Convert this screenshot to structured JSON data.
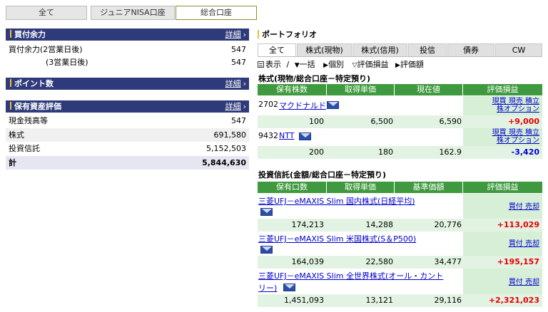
{
  "account_tabs": [
    "全て",
    "ジュニアNISA口座",
    "総合口座"
  ],
  "left": {
    "buying_power": {
      "title": "買付余力",
      "detail": "詳細",
      "arrow": "›",
      "rows": [
        {
          "label": "買付余力(2営業日後)",
          "value": "547"
        },
        {
          "label": "(3営業日後)",
          "value": "547"
        }
      ]
    },
    "points": {
      "title": "ポイント数",
      "detail": "詳細",
      "arrow": "›"
    },
    "asset_valuation": {
      "title": "保有資産評価",
      "detail": "詳細",
      "arrow": "›",
      "rows": [
        {
          "label": "現金残高等",
          "value": "547"
        },
        {
          "label": "株式",
          "value": "691,580"
        },
        {
          "label": "投資信託",
          "value": "5,152,503"
        },
        {
          "label": "計",
          "value": "5,844,630"
        }
      ]
    }
  },
  "portfolio": {
    "title": "ポートフォリオ",
    "tabs": [
      "全て",
      "株式(現物)",
      "株式(信用)",
      "投信",
      "債券",
      "CW"
    ],
    "toolbar": {
      "display_icon": "list-icon",
      "display": "表示",
      "sep": "/",
      "bulk_arrow": "▼",
      "bulk": "一括",
      "individual_arrow": "▶",
      "individual": "個別",
      "pl_arrow": "▽",
      "pl": "評価損益",
      "amount_arrow": "▶",
      "amount": "評価額"
    },
    "stocks": {
      "section_title": "株式(現物/総合口座－特定預り)",
      "headers": [
        "保有株数",
        "取得単価",
        "現在値",
        "評価損益"
      ],
      "rows": [
        {
          "code": "2702",
          "name": "マクドナルド",
          "links1": "現買 現売 積立",
          "links2": "株オプション",
          "qty": "100",
          "cost": "6,500",
          "price": "6,590",
          "pl": "+9,000"
        },
        {
          "code": "9432",
          "name": "NTT",
          "links1": "現買 現売 積立",
          "links2": "株オプション",
          "qty": "200",
          "cost": "180",
          "price": "162.9",
          "pl": "-3,420"
        }
      ]
    },
    "funds": {
      "section_title": "投資信託(金額/総合口座－特定預り)",
      "headers": [
        "保有口数",
        "取得単価",
        "基準価額",
        "評価損益"
      ],
      "rows": [
        {
          "name": "三菱UFJ－eMAXIS Slim 国内株式(日経平均)",
          "links": "買付 売却",
          "units": "174,213",
          "cost": "14,288",
          "nav": "20,776",
          "pl": "+113,029"
        },
        {
          "name": "三菱UFJ－eMAXIS Slim 米国株式(S＆P500)",
          "links": "買付 売却",
          "units": "164,039",
          "cost": "22,580",
          "nav": "34,477",
          "pl": "+195,157"
        },
        {
          "name": "三菱UFJ－eMAXIS Slim 全世界株式(オール・カント",
          "name_cont": "リー)",
          "links": "買付 売却",
          "units": "1,451,093",
          "cost": "13,121",
          "nav": "29,116",
          "pl": "+2,321,023"
        }
      ]
    }
  }
}
